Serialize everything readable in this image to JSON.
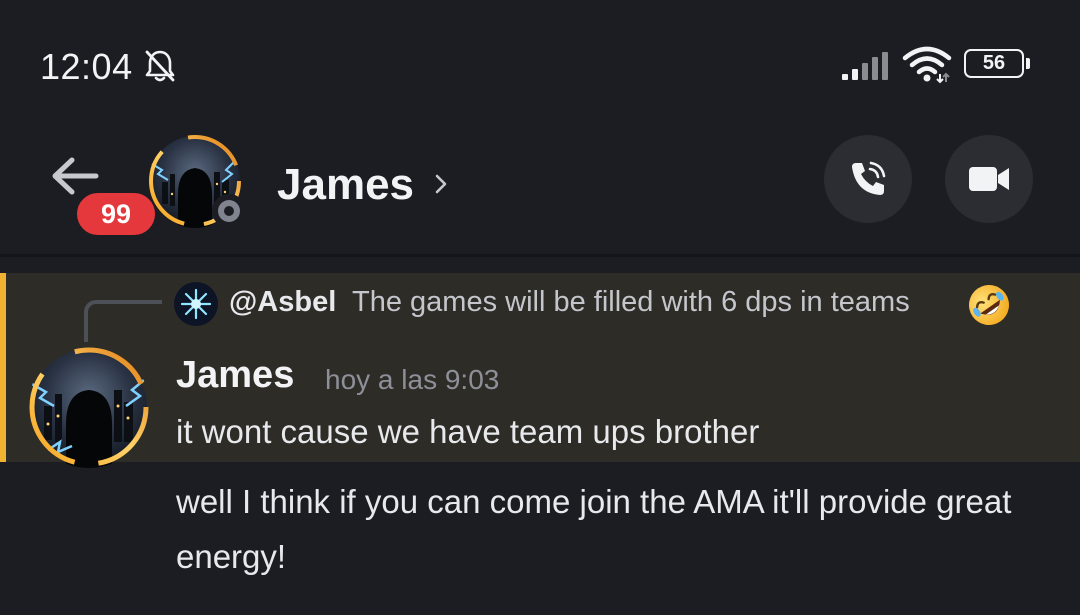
{
  "status_bar": {
    "time": "12:04",
    "battery_level": "56",
    "icons": [
      "bell-off-icon",
      "signal-icon",
      "wifi-icon",
      "battery-icon"
    ]
  },
  "header": {
    "back_icon": "arrow-left-icon",
    "unread_count": "99",
    "contact_name": "James",
    "presence": "offline",
    "actions": [
      "phone-call-icon",
      "video-camera-icon"
    ]
  },
  "messages": {
    "reply": {
      "author": "@Asbel",
      "text": "The games will be filled with 6 dps in teams",
      "emoji": "rolling-on-floor-laughing-emoji"
    },
    "main": {
      "author": "James",
      "timestamp": "hoy a las 9:03",
      "text": "it wont cause we have team ups brother"
    },
    "followup": {
      "text": "well I think if you can come join the AMA it'll provide great energy!"
    }
  },
  "colors": {
    "background": "#1c1d22",
    "mention_highlight": "#2e2c27",
    "mention_bar": "#f0b232",
    "badge": "#e5383c",
    "button_bg": "#2b2d33"
  }
}
